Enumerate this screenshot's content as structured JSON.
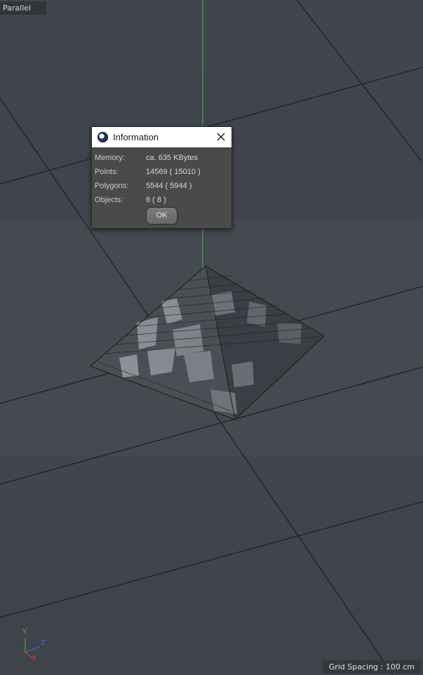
{
  "viewport": {
    "projection_label": "Parallel",
    "grid_spacing": "Grid Spacing : 100 cm"
  },
  "axis_gizmo": {
    "x": "X",
    "y": "Y",
    "z": "Z"
  },
  "dialog": {
    "title": "Information",
    "rows": [
      {
        "label": "Memory:",
        "value": "ca. 635 KBytes"
      },
      {
        "label": "Points:",
        "value": "14569 ( 15010 )"
      },
      {
        "label": "Polygons:",
        "value": "5544 ( 5944 )"
      },
      {
        "label": "Objects:",
        "value": "6 ( 8 )"
      }
    ],
    "ok_label": "OK"
  },
  "colors": {
    "y_axis": "#3fbf3f",
    "x_axis": "#d83a3a",
    "z_axis": "#3a6fd8"
  }
}
